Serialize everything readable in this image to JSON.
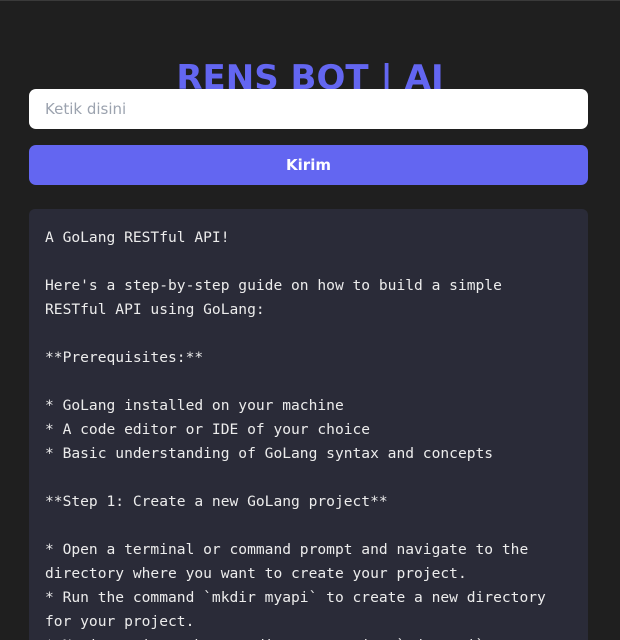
{
  "app": {
    "title": "RENS BOT | AI"
  },
  "prompt": {
    "placeholder": "Ketik disini",
    "value": ""
  },
  "actions": {
    "send_label": "Kirim"
  },
  "response": {
    "text": "A GoLang RESTful API!\n\nHere's a step-by-step guide on how to build a simple\nRESTful API using GoLang:\n\n**Prerequisites:**\n\n* GoLang installed on your machine\n* A code editor or IDE of your choice\n* Basic understanding of GoLang syntax and concepts\n\n**Step 1: Create a new GoLang project**\n\n* Open a terminal or command prompt and navigate to the\ndirectory where you want to create your project.\n* Run the command `mkdir myapi` to create a new directory\nfor your project.\n* Navigate into the new directory using `cd myapi`."
  },
  "colors": {
    "background": "#1f1f1f",
    "accent": "#6366f1",
    "panel": "#2a2b38"
  }
}
